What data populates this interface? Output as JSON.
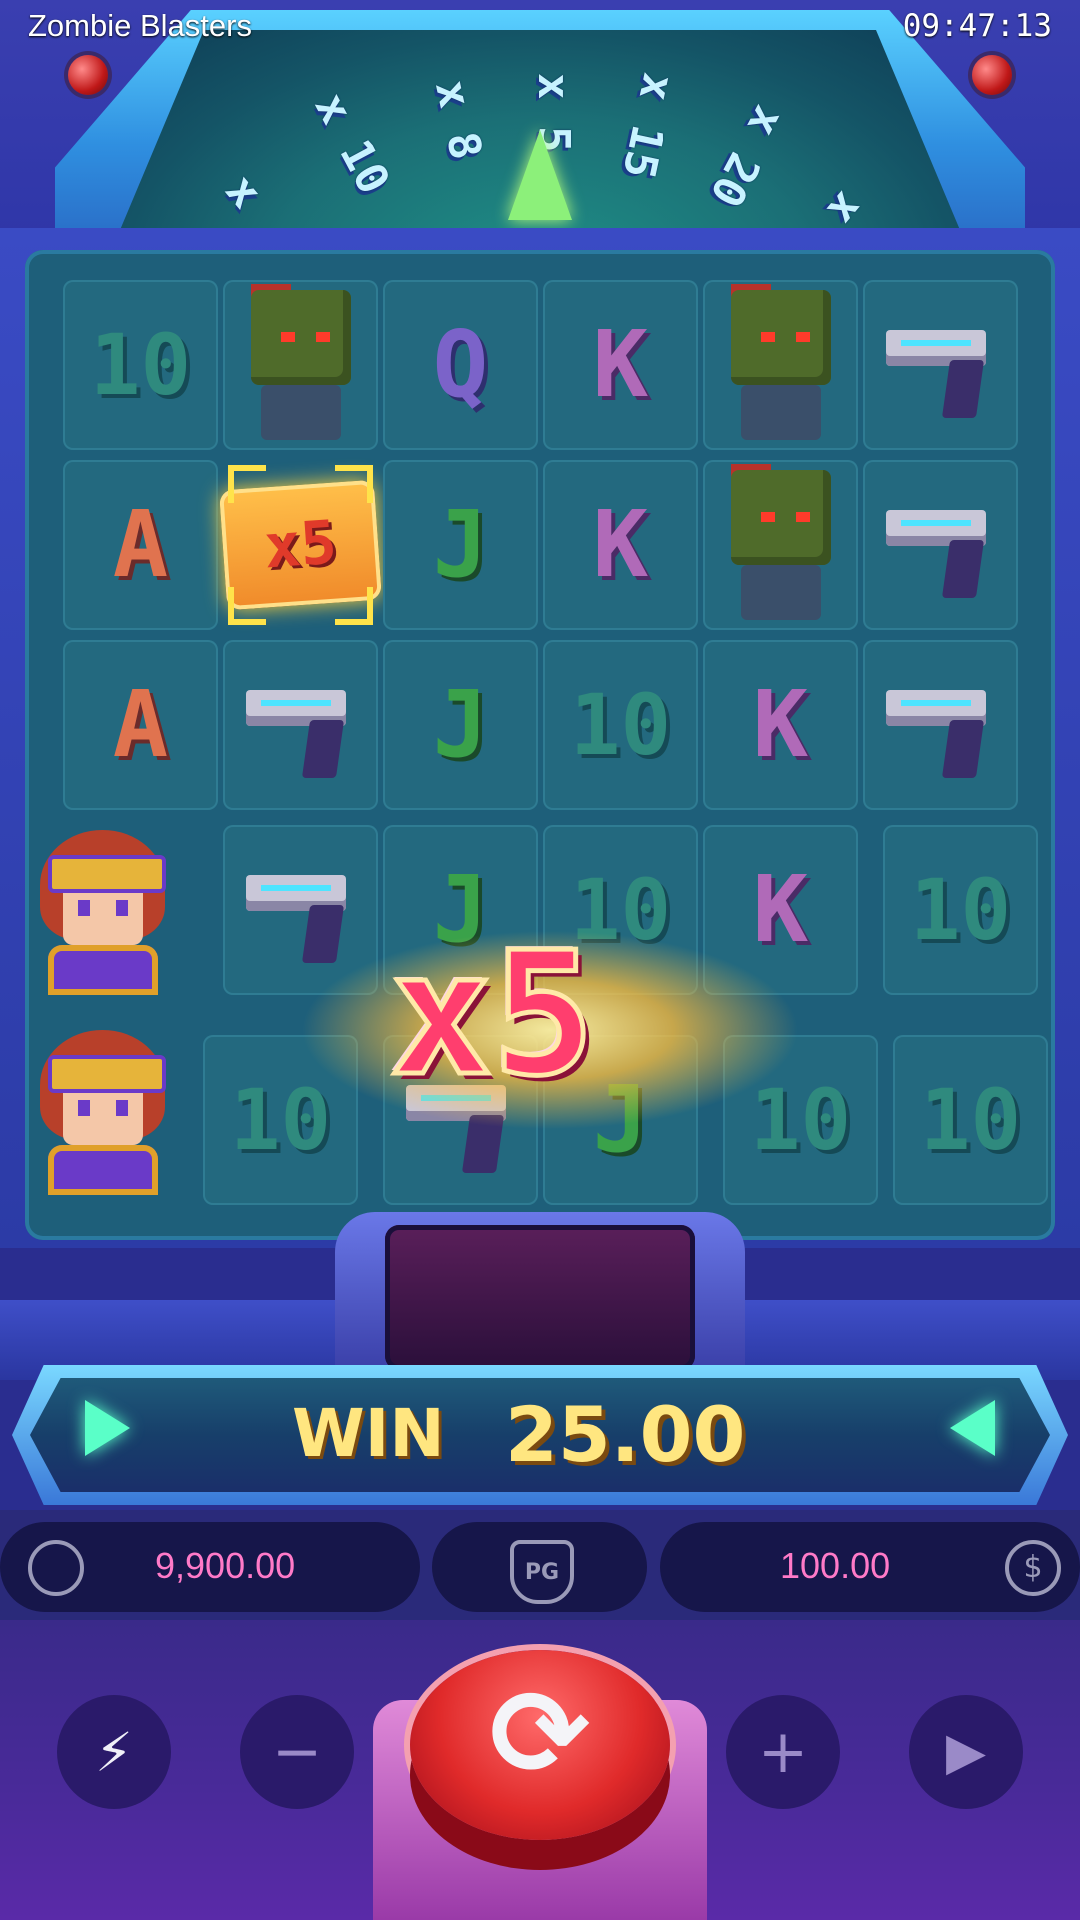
{
  "header": {
    "title": "Zombie Blasters",
    "clock": "09:47:13"
  },
  "wheel": {
    "segments": [
      "x",
      "x 10",
      "x 8",
      "x 5",
      "x 15",
      "x 20",
      "x"
    ]
  },
  "grid": {
    "rows": [
      [
        "10",
        "zombie",
        "Q",
        "K",
        "zombie",
        "gun"
      ],
      [
        "A",
        "x5",
        "J",
        "K",
        "zombie",
        "gun"
      ],
      [
        "A",
        "gun",
        "J",
        "10",
        "K",
        "gun"
      ],
      [
        "hero",
        "gun",
        "J",
        "10",
        "K",
        "10"
      ],
      [
        "hero",
        "10",
        "gun",
        "J",
        "10",
        "10"
      ]
    ]
  },
  "multiplier_tile": "x5",
  "big_multiplier": "x5",
  "win": {
    "label": "WIN",
    "amount": "25.00"
  },
  "balance": {
    "value": "9,900.00",
    "icon": "user-icon"
  },
  "bet": {
    "value": "100.00",
    "icon": "dollar-coin-icon"
  },
  "provider_logo": "PG",
  "controls": {
    "turbo_icon": "turbo-off-icon",
    "minus": "−",
    "plus": "+",
    "autoplay_icon": "autoplay-icon",
    "spin_icon": "spin-icon"
  },
  "colors": {
    "accent_win": "#ffe680",
    "value_pink": "#ff7ac8",
    "spin_red": "#e02a2a",
    "multiplier_pink": "#ff3e6e"
  }
}
